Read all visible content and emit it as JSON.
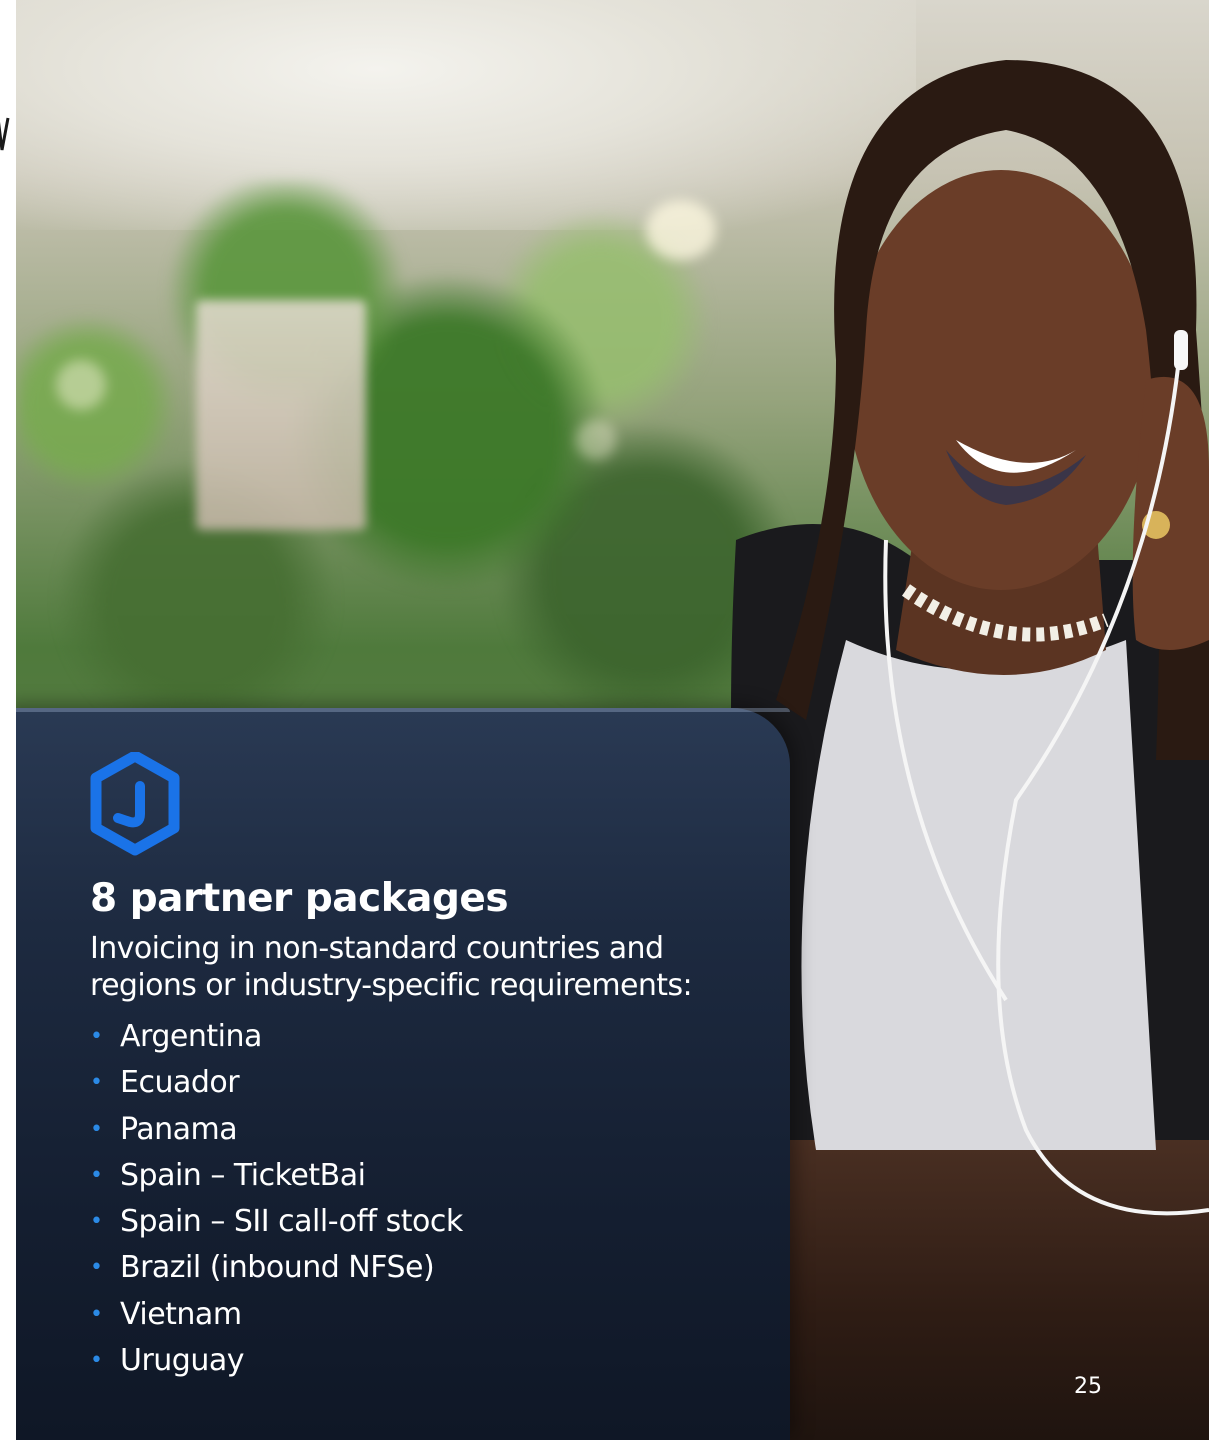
{
  "slide": {
    "heading": "8 partner packages",
    "intro": "Invoicing in non-standard countries and regions or industry-specific requirements:",
    "countries": [
      "Argentina",
      "Ecuador",
      "Panama",
      "Spain – TicketBai",
      "Spain – SII call-off stock",
      "Brazil (inbound NFSe)",
      "Vietnam",
      "Uruguay"
    ],
    "bullet_glyph": "•",
    "page_number": "25"
  },
  "icons": {
    "logo": "hexagon-link-icon"
  },
  "colors": {
    "accent_blue": "#1a73e8",
    "panel_dark": "#141e30",
    "text": "#ffffff"
  }
}
